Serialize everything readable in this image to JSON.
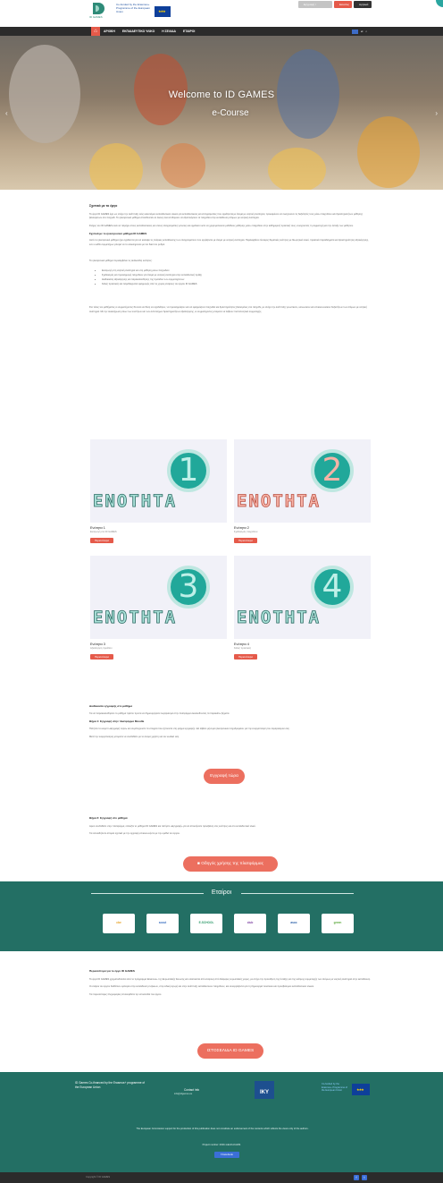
{
  "header": {
    "logo_text": "ID GAMES",
    "eu_text": "Co-funded by the Erasmus+ Programme of the European Union",
    "buttons": [
      "Εγγραφή / Σύνδεση",
      "Είσοδος",
      "Αγγλικά"
    ]
  },
  "nav": {
    "home_icon": "home-icon",
    "items": [
      "ΑΡΧΙΚΗ",
      "ΕΚΠΑΙΔΕΥΤΙΚΟ ΥΛΙΚΟ",
      "Η ΣΕΛΙΔΑ",
      "ΕΤΑΙΡΟΙ"
    ],
    "lang": "el",
    "search_icon": "search-icon"
  },
  "hero": {
    "title": "Welcome to ID GAMES",
    "subtitle": "e-Course"
  },
  "intro": {
    "heading1": "Σχετικά με το έργο",
    "p1": "Το έργο ID GAMES έχει ως στόχο την ανάπτυξη ενός καινοτόμου εκπαιδευτικού υλικού για εκπαιδευτικούς και επαγγελματίες που εργάζονται με άτομα με νοητική αναπηρία, προκειμένου να ενισχύσουν τις δεξιότητές τους μέσω παιχνιδιών και δραστηριοτήτων μάθησης βασισμένων στο παιχνίδι. Το ηλεκτρονικό μάθημα απευθύνεται σε όλους όσοι επιθυμούν να αξιοποιήσουν τα παιχνίδια στην εκπαίδευση ατόμων με νοητική αναπηρία.",
    "p2": "Στόχος του ID GAMES είναι να παρέχει στους εκπαιδευτικούς και στους επαγγελματίες γνώσεις και εργαλεία ώστε να χρησιμοποιούν μεθόδους μάθησης μέσω παιχνιδιού στην καθημερινή πρακτική τους, ενισχύοντας τη συμμετοχή και την ένταξη των μαθητών.",
    "heading2": "Σχετικά με το ηλεκτρονικό μάθημα ID GAMES",
    "p3": "Αυτό το ηλεκτρονικό μάθημα έχει σχεδιαστεί για να καλύψει τις ανάγκες εκπαίδευσης των επαγγελματιών που εργάζονται με άτομα με νοητική αναπηρία. Περιλαμβάνει τέσσερις θεματικές ενότητες με θεωρητικό υλικό, πρακτικά παραδείγματα και δραστηριότητες αξιολόγησης, ενώ ο κάθε συμμετέχων μπορεί να το ολοκληρώσει με τον δικό του ρυθμό.",
    "list_intro": "Το ηλεκτρονικό μάθημα περιλαμβάνει τις ακόλουθες ενότητες:",
    "bullets": [
      "Εισαγωγή στη νοητική αναπηρία και στη μάθηση μέσω παιχνιδιού",
      "Σχεδιασμός και προσαρμογή παιχνιδιών για άτομα με νοητική αναπηρία στην εκπαιδευτική πράξη",
      "Διαδικασίες αξιολόγησης και παρακολούθησης της προόδου των συμμετεχόντων",
      "Καλές πρακτικές και παραδείγματα εφαρμογής από τις χώρες-εταίρους του έργου ID GAMES"
    ],
    "p4": "Στο τέλος του μαθήματος οι συμμετέχοντες θα είναι σε θέση να σχεδιάζουν, να προσαρμόζουν και να εφαρμόζουν παιχνίδια και δραστηριότητες βασισμένες στο παιχνίδι, με στόχο την ανάπτυξη γνωστικών, κοινωνικών και επικοινωνιακών δεξιοτήτων των ατόμων με νοητική αναπηρία. Με την ολοκλήρωση όλων των ενοτήτων και των αντίστοιχων δραστηριοτήτων αξιολόγησης, οι συμμετέχοντες μπορούν να λάβουν πιστοποιητικό συμμετοχής."
  },
  "modules": [
    {
      "word": "ΕΝΟΤΗΤΑ",
      "number": "1",
      "title": "Ενότητα 1",
      "sub": "Εισαγωγή στο ID GAMES",
      "button": "Περισσότερα"
    },
    {
      "word": "ΕΝΟΤΗΤΑ",
      "number": "2",
      "title": "Ενότητα 2",
      "sub": "Σχεδιασμός παιχνιδιών",
      "button": "Περισσότερα"
    },
    {
      "word": "ΕΝΟΤΗΤΑ",
      "number": "3",
      "title": "Ενότητα 3",
      "sub": "Αξιολόγηση προόδου",
      "button": "Περισσότερα"
    },
    {
      "word": "ΕΝΟΤΗΤΑ",
      "number": "4",
      "title": "Ενότητα 4",
      "sub": "Καλές πρακτικές",
      "button": "Περισσότερα"
    }
  ],
  "register": {
    "heading1": "Διαδικασία εγγραφής στο μάθημα",
    "p1": "Για να παρακολουθήσετε το μάθημα πρέπει πρώτα να δημιουργήσετε λογαριασμό στην πλατφόρμα ακολουθώντας τα παρακάτω βήματα.",
    "heading2": "Βήμα 1: Εγγραφή στην πλατφόρμα Moodle",
    "p2": "Πατήστε το κουμπί «Εγγραφή τώρα» και συμπληρώστε τα στοιχεία που ζητούνται στη φόρμα εγγραφής. Θα λάβετε μήνυμα ηλεκτρονικού ταχυδρομείου για την ενεργοποίηση του λογαριασμού σας.",
    "p3": "Μετά την ενεργοποίηση μπορείτε να συνδεθείτε με το όνομα χρήστη και τον κωδικό σας.",
    "button": "Εγγραφή τώρα"
  },
  "enroll": {
    "heading": "Βήμα 2: Εγγραφή στο μάθημα",
    "p1": "Αφού συνδεθείτε στην πλατφόρμα, επιλέξτε το μάθημα ID GAMES και πατήστε «Εγγραφή» για να αποκτήσετε πρόσβαση στις ενότητες και στο εκπαιδευτικό υλικό.",
    "p2": "Για οποιαδήποτε απορία σχετικά με την εγγραφή επικοινωνήστε με την ομάδα του έργου.",
    "button": "Οδηγός χρήσης της πλατφόρμας"
  },
  "partners": {
    "title": "Εταίροι",
    "logos": [
      "cbe",
      "scout",
      "E-SCHOOL",
      "club",
      "asoc",
      "green"
    ]
  },
  "about": {
    "heading": "Περισσότερα για το έργο ID GAMES",
    "p1": "Το έργο ID GAMES χρηματοδοτείται από το πρόγραμμα Erasmus+ της Ευρωπαϊκής Ένωσης και υλοποιείται από εταίρους από διάφορες ευρωπαϊκές χώρες, με στόχο την προώθηση της ένταξης και της ισότιμης συμμετοχής των ατόμων με νοητική αναπηρία στην εκπαίδευση.",
    "p2": "Οι εταίροι του έργου διαθέτουν εμπειρία στην εκπαίδευση ενηλίκων, στην ειδική αγωγή και στην ανάπτυξη εκπαιδευτικών παιχνιδιών, και συνεργάζονται για τη δημιουργία ποιοτικού και προσβάσιμου εκπαιδευτικού υλικού.",
    "p3": "Για περισσότερες πληροφορίες επισκεφθείτε την ιστοσελίδα του έργου.",
    "button": "ΙΣΤΟΣΕΛΙΔΑ ID GAMES"
  },
  "footer": {
    "org": "ID Games Co-financed by the Erasmus+ programme of the European Union",
    "contact_label": "Contact Info",
    "contact_sub": "info@idgames.eu",
    "iky": "IKY",
    "eu_text": "Co-funded by the Erasmus+ Programme of the European Union",
    "disclaimer": "The European Commission support for the production of this publication does not constitute an endorsement of the contents which reflects the views only of the authors.",
    "contact_line": "Project number: 2020-1-EL01-KA204",
    "facebook": "f Facebook"
  },
  "bottom": {
    "copyright": "Copyright © ID GAMES"
  },
  "colors": {
    "accent": "#e55a4a",
    "teal": "#236f64",
    "dark": "#2b2b2b"
  }
}
